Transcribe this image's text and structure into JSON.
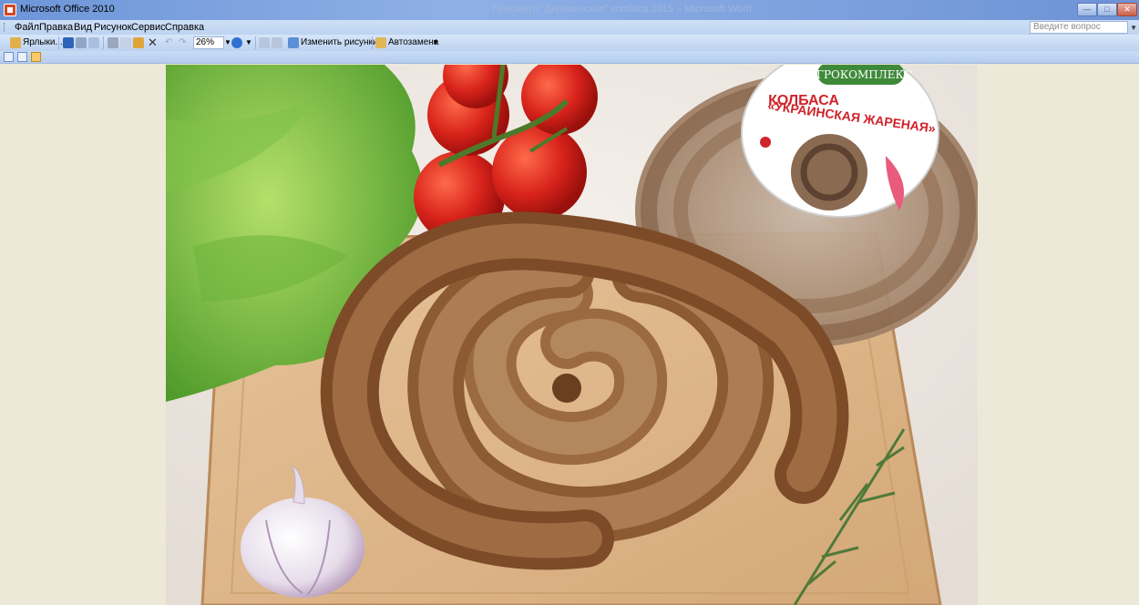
{
  "window": {
    "title": "Microsoft Office 2010",
    "document_title": "Просмотр \"Деревенская\" колбаса 2015 – Microsoft Word"
  },
  "menu": [
    {
      "id": "file",
      "label": "Файл"
    },
    {
      "id": "edit",
      "label": "Правка"
    },
    {
      "id": "view",
      "label": "Вид"
    },
    {
      "id": "picture",
      "label": "Рисунок"
    },
    {
      "id": "tools",
      "label": "Сервис"
    },
    {
      "id": "help",
      "label": "Справка"
    }
  ],
  "search": {
    "placeholder": "Введите вопрос"
  },
  "toolbar": {
    "shortcuts_label": "Ярлыки...",
    "zoom_value": "26%",
    "edit_pictures_label": "Изменить рисунки...",
    "autocorrect_label": "Автозамена"
  },
  "image": {
    "package_brand": "АГРОКОМПЛЕКС",
    "package_product_line1": "КОЛБАСА",
    "package_product_line2": "«УКРАИНСКАЯ ЖАРЕНАЯ»"
  },
  "colors": {
    "workspace": "#ECE9D8",
    "titlebar": "#6c95d8",
    "accent_red": "#d0232a",
    "brand_green": "#3f8a3a"
  }
}
